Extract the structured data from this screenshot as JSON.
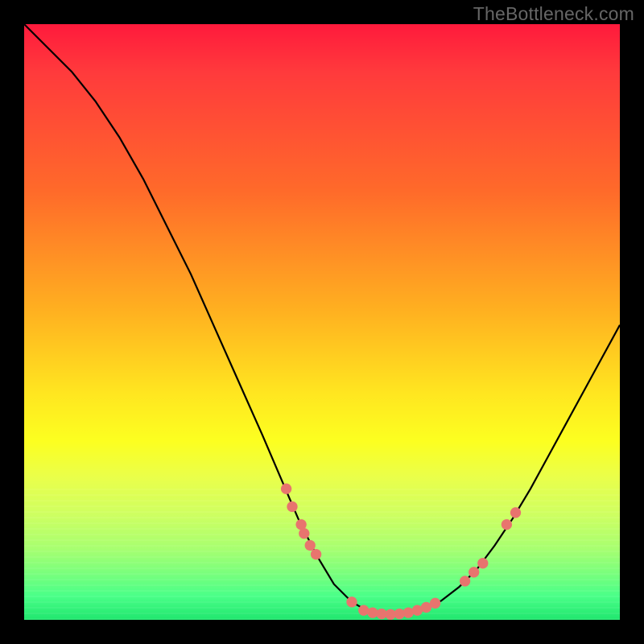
{
  "attribution": "TheBottleneck.com",
  "colors": {
    "background": "#000000",
    "gradient_top": "#ff1a3c",
    "gradient_mid1": "#ffb020",
    "gradient_mid2": "#fcff20",
    "gradient_bottom": "#20e66e",
    "curve_stroke": "#000000",
    "point_fill": "#e8746e"
  },
  "chart_data": {
    "type": "line",
    "title": "",
    "xlabel": "",
    "ylabel": "",
    "xlim": [
      0,
      100
    ],
    "ylim": [
      0,
      100
    ],
    "grid": false,
    "legend": false,
    "curve": [
      {
        "x": 0.0,
        "y": 100.0
      },
      {
        "x": 4.0,
        "y": 96.0
      },
      {
        "x": 8.0,
        "y": 92.0
      },
      {
        "x": 12.0,
        "y": 87.0
      },
      {
        "x": 16.0,
        "y": 81.0
      },
      {
        "x": 20.0,
        "y": 74.0
      },
      {
        "x": 24.0,
        "y": 66.0
      },
      {
        "x": 28.0,
        "y": 58.0
      },
      {
        "x": 32.0,
        "y": 49.0
      },
      {
        "x": 36.0,
        "y": 40.0
      },
      {
        "x": 40.0,
        "y": 31.0
      },
      {
        "x": 43.0,
        "y": 24.0
      },
      {
        "x": 46.0,
        "y": 17.0
      },
      {
        "x": 49.0,
        "y": 11.0
      },
      {
        "x": 52.0,
        "y": 6.0
      },
      {
        "x": 55.0,
        "y": 3.0
      },
      {
        "x": 58.0,
        "y": 1.3
      },
      {
        "x": 61.0,
        "y": 0.8
      },
      {
        "x": 64.0,
        "y": 1.0
      },
      {
        "x": 67.0,
        "y": 1.8
      },
      {
        "x": 70.0,
        "y": 3.2
      },
      {
        "x": 73.0,
        "y": 5.5
      },
      {
        "x": 76.0,
        "y": 8.5
      },
      {
        "x": 79.0,
        "y": 12.5
      },
      {
        "x": 82.0,
        "y": 17.0
      },
      {
        "x": 85.0,
        "y": 22.0
      },
      {
        "x": 88.0,
        "y": 27.5
      },
      {
        "x": 91.0,
        "y": 33.0
      },
      {
        "x": 94.0,
        "y": 38.5
      },
      {
        "x": 97.0,
        "y": 44.0
      },
      {
        "x": 100.0,
        "y": 49.5
      }
    ],
    "points": [
      {
        "x": 44.0,
        "y": 22.0
      },
      {
        "x": 45.0,
        "y": 19.0
      },
      {
        "x": 46.5,
        "y": 16.0
      },
      {
        "x": 47.0,
        "y": 14.5
      },
      {
        "x": 48.0,
        "y": 12.5
      },
      {
        "x": 49.0,
        "y": 11.0
      },
      {
        "x": 55.0,
        "y": 3.0
      },
      {
        "x": 57.0,
        "y": 1.6
      },
      {
        "x": 58.5,
        "y": 1.2
      },
      {
        "x": 60.0,
        "y": 1.0
      },
      {
        "x": 61.5,
        "y": 0.9
      },
      {
        "x": 63.0,
        "y": 1.0
      },
      {
        "x": 64.5,
        "y": 1.2
      },
      {
        "x": 66.0,
        "y": 1.6
      },
      {
        "x": 67.5,
        "y": 2.1
      },
      {
        "x": 69.0,
        "y": 2.8
      },
      {
        "x": 74.0,
        "y": 6.5
      },
      {
        "x": 75.5,
        "y": 8.0
      },
      {
        "x": 77.0,
        "y": 9.5
      },
      {
        "x": 81.0,
        "y": 16.0
      },
      {
        "x": 82.5,
        "y": 18.0
      }
    ]
  }
}
